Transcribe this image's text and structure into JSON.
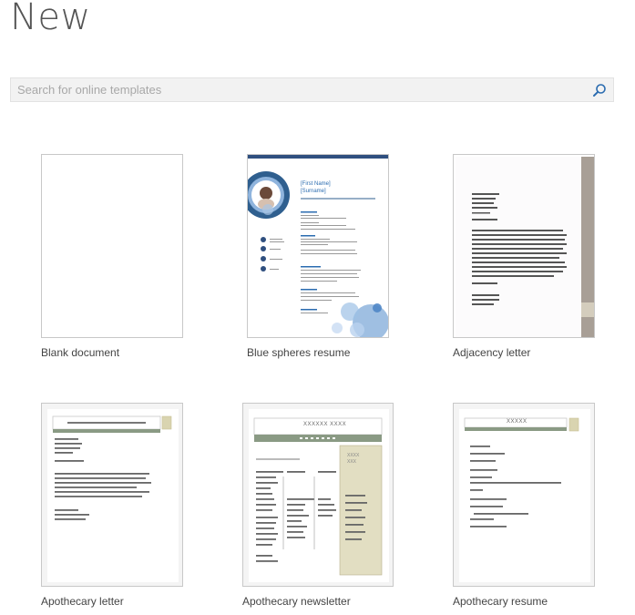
{
  "page": {
    "title": "New"
  },
  "search": {
    "placeholder": "Search for online templates",
    "icon": "search-icon"
  },
  "templates": [
    {
      "label": "Blank document"
    },
    {
      "label": "Blue spheres resume",
      "thumb_text": {
        "first_name": "[First Name]",
        "surname": "[Surname]"
      }
    },
    {
      "label": "Adjacency letter"
    },
    {
      "label": "Apothecary letter"
    },
    {
      "label": "Apothecary newsletter",
      "thumb_text": {
        "masthead": "XXXXXX XXXX",
        "sidebar": "XXXX\nXXX"
      }
    },
    {
      "label": "Apothecary resume",
      "thumb_text": {
        "masthead": "XXXXX"
      }
    }
  ],
  "colors": {
    "accent_blue": "#2b6cb0",
    "sphere_blue": "#5b9bd5",
    "apothecary_green": "#8a9a84",
    "apothecary_tan": "#d9d4b0",
    "adjacency_gray": "#a79f95"
  }
}
